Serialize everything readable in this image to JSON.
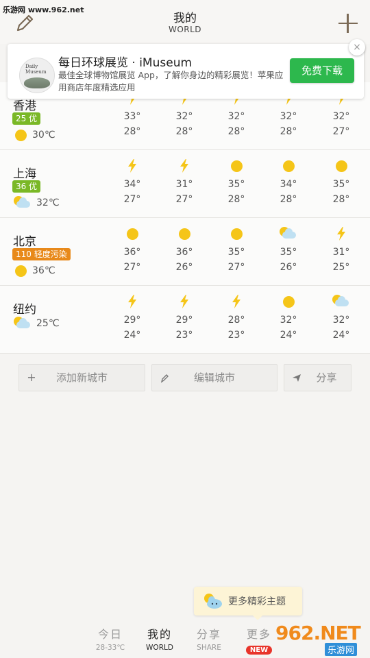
{
  "watermark": "乐游网 www.962.net",
  "header": {
    "title": "我的",
    "subtitle": "WORLD"
  },
  "ad": {
    "title": "每日环球展览 · iMuseum",
    "description": "最佳全球博物馆展览 App，了解你身边的精彩展览！苹果应用商店年度精选应用",
    "button_label": "免费下载",
    "logo_text": "Daily Museum",
    "close_label": "×"
  },
  "cities": [
    {
      "name": "香港",
      "aqi": "25 优",
      "aqi_color": "#7ab826",
      "now_icon": "sun",
      "now_temp": "30℃",
      "days": [
        {
          "icon": "lightning",
          "hi": "33°",
          "lo": "28°"
        },
        {
          "icon": "lightning",
          "hi": "32°",
          "lo": "28°"
        },
        {
          "icon": "lightning",
          "hi": "32°",
          "lo": "28°"
        },
        {
          "icon": "lightning",
          "hi": "32°",
          "lo": "28°"
        },
        {
          "icon": "lightning",
          "hi": "32°",
          "lo": "27°"
        }
      ]
    },
    {
      "name": "上海",
      "aqi": "36 优",
      "aqi_color": "#7ab826",
      "now_icon": "partly-cloudy",
      "now_temp": "32℃",
      "days": [
        {
          "icon": "lightning",
          "hi": "34°",
          "lo": "27°"
        },
        {
          "icon": "lightning",
          "hi": "31°",
          "lo": "27°"
        },
        {
          "icon": "sun",
          "hi": "35°",
          "lo": "28°"
        },
        {
          "icon": "sun",
          "hi": "34°",
          "lo": "28°"
        },
        {
          "icon": "sun",
          "hi": "35°",
          "lo": "28°"
        }
      ]
    },
    {
      "name": "北京",
      "aqi": "110 轻度污染",
      "aqi_color": "#e8891a",
      "now_icon": "sun",
      "now_temp": "36℃",
      "days": [
        {
          "icon": "sun",
          "hi": "36°",
          "lo": "27°"
        },
        {
          "icon": "sun",
          "hi": "36°",
          "lo": "26°"
        },
        {
          "icon": "sun",
          "hi": "35°",
          "lo": "27°"
        },
        {
          "icon": "partly-cloudy",
          "hi": "35°",
          "lo": "26°"
        },
        {
          "icon": "lightning",
          "hi": "31°",
          "lo": "25°"
        }
      ]
    },
    {
      "name": "纽约",
      "aqi": "",
      "aqi_color": "",
      "now_icon": "partly-cloudy",
      "now_temp": "25℃",
      "days": [
        {
          "icon": "lightning",
          "hi": "29°",
          "lo": "24°"
        },
        {
          "icon": "lightning",
          "hi": "29°",
          "lo": "23°"
        },
        {
          "icon": "lightning",
          "hi": "28°",
          "lo": "23°"
        },
        {
          "icon": "sun",
          "hi": "32°",
          "lo": "24°"
        },
        {
          "icon": "partly-cloudy",
          "hi": "32°",
          "lo": "24°"
        }
      ]
    }
  ],
  "actions": {
    "add_city": "添加新城市",
    "edit_city": "编辑城市",
    "share": "分享"
  },
  "theme_tip": "更多精彩主题",
  "tabs": [
    {
      "label": "今日",
      "sub": "28-33℃"
    },
    {
      "label": "我的",
      "sub": "WORLD"
    },
    {
      "label": "分享",
      "sub": "SHARE"
    },
    {
      "label": "更多",
      "badge": "NEW"
    }
  ],
  "brand_logo": {
    "main": "962.NET",
    "sub": "乐游网"
  },
  "colors": {
    "sun": "#f5c518",
    "accent_brown": "#7b6a56",
    "download_green": "#2db84d",
    "new_badge": "#e8342a"
  }
}
